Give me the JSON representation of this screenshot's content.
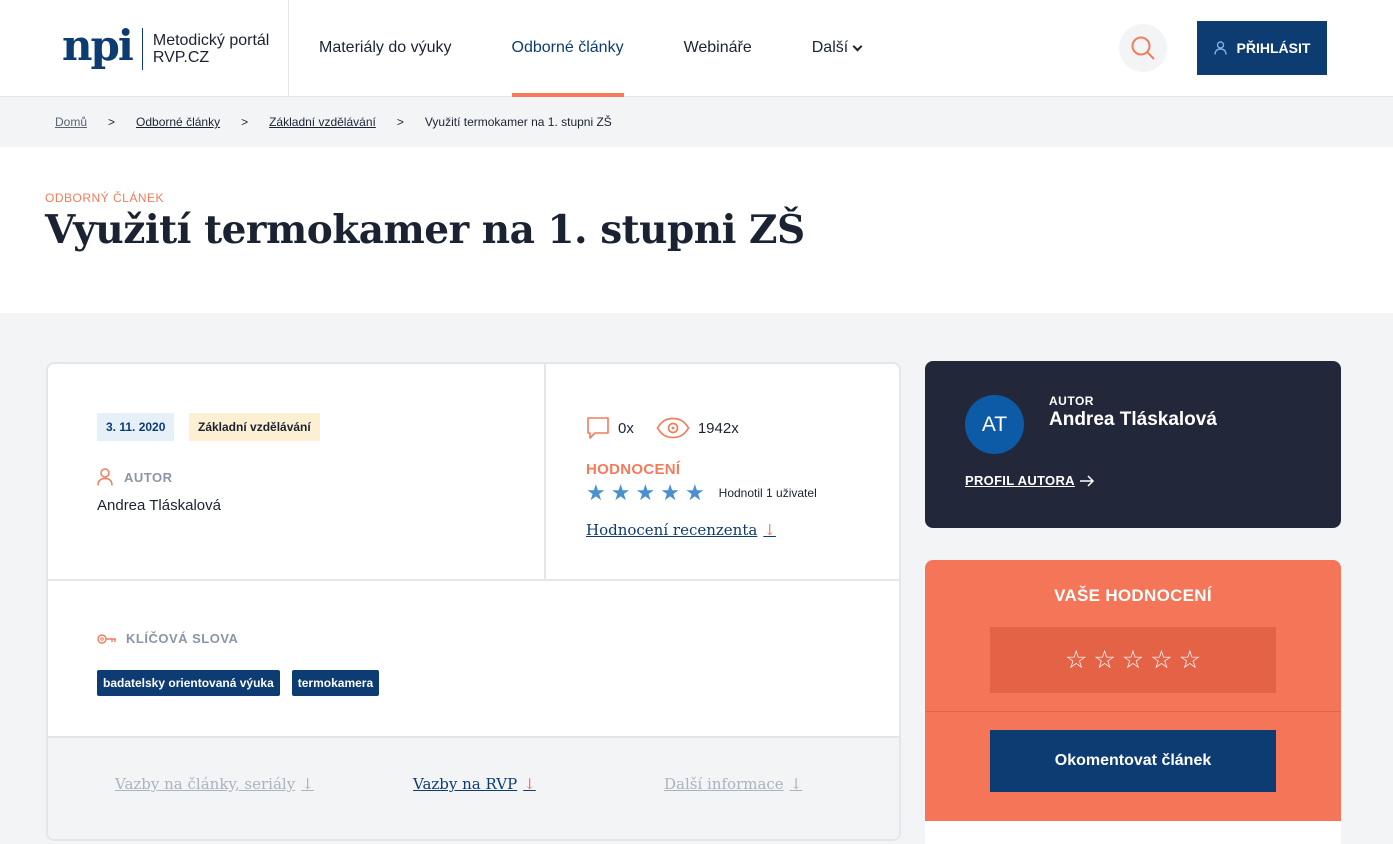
{
  "header": {
    "logo_mark": "npi",
    "logo_line1": "Metodický portál",
    "logo_line2": "RVP.CZ",
    "nav": [
      {
        "label": "Materiály do výuky",
        "active": false
      },
      {
        "label": "Odborné články",
        "active": true
      },
      {
        "label": "Webináře",
        "active": false
      },
      {
        "label": "Další",
        "active": false
      }
    ],
    "search_icon": "search-icon",
    "login_label": "PŘIHLÁSIT"
  },
  "breadcrumb": [
    "Domů",
    "Odborné články",
    "Základní vzdělávání",
    "Využití termokamer na 1. stupni ZŠ"
  ],
  "breadcrumb_separator": ">",
  "article": {
    "type": "ODBORNÝ ČLÁNEK",
    "title": "Využití termokamer na 1. stupni ZŠ",
    "date": "3. 11. 2020",
    "level": "Základní vzdělávání",
    "author_label": "AUTOR",
    "author_name": "Andrea Tláskalová",
    "comments": "0x",
    "views": "1942x",
    "rating_label": "HODNOCENÍ",
    "rating_stars": 5,
    "rating_count": "Hodnotil 1 uživatel",
    "review_link": "Hodnocení recenzenta",
    "keywords_label": "KLÍČOVÁ SLOVA",
    "keywords": [
      "badatelsky orientovaná výuka",
      "termokamera"
    ],
    "tabs": [
      {
        "label": "Vazby na články, seriály",
        "active": false
      },
      {
        "label": "Vazby na RVP",
        "active": true
      },
      {
        "label": "Další informace",
        "active": false
      }
    ]
  },
  "author_card": {
    "initials": "AT",
    "label": "AUTOR",
    "name": "Andrea Tláskalová",
    "profile_link": "PROFIL AUTORA"
  },
  "rating_card": {
    "title": "VAŠE HODNOCENÍ",
    "stars": 5,
    "comment_button": "Okomentovat článek"
  },
  "colors": {
    "brand": "#0d3c73",
    "accent": "#f47b5b",
    "star": "#4a90cf",
    "dark_card": "#22283a"
  }
}
